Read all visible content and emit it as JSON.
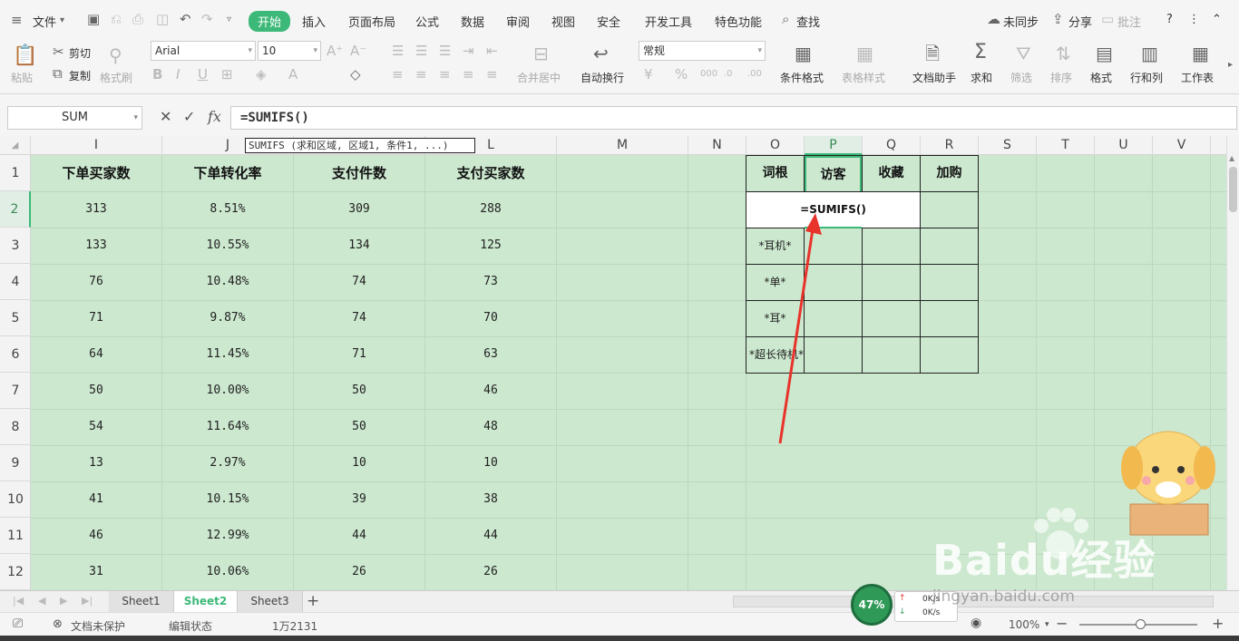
{
  "menu": {
    "file": "文件",
    "items": [
      "开始",
      "插入",
      "页面布局",
      "公式",
      "数据",
      "审阅",
      "视图",
      "安全",
      "开发工具",
      "特色功能"
    ],
    "search": "查找",
    "sync": "未同步",
    "share": "分享",
    "comment": "批注"
  },
  "ribbon": {
    "paste": "粘贴",
    "cut": "剪切",
    "copy": "复制",
    "format_painter": "格式刷",
    "font": "Arial",
    "size": "10",
    "merge": "合并居中",
    "wrap": "自动换行",
    "number_format": "常规",
    "cond_format": "条件格式",
    "table_style": "表格样式",
    "doc_helper": "文档助手",
    "sum": "求和",
    "filter": "筛选",
    "sort": "排序",
    "format": "格式",
    "rowcol": "行和列",
    "sheet": "工作表"
  },
  "formula_bar": {
    "name_box": "SUM",
    "fx": "fx",
    "formula": "=SUMIFS()"
  },
  "tooltip": "SUMIFS (求和区域, 区域1, 条件1, ...)",
  "columns": [
    "I",
    "J",
    "K",
    "L",
    "M",
    "N",
    "O",
    "P",
    "Q",
    "R",
    "S",
    "T",
    "U",
    "V"
  ],
  "rows": [
    "1",
    "2",
    "3",
    "4",
    "5",
    "6",
    "7",
    "8",
    "9",
    "10",
    "11",
    "12"
  ],
  "data_headers": [
    "下单买家数",
    "下单转化率",
    "支付件数",
    "支付买家数"
  ],
  "data_rows": [
    [
      "313",
      "8.51%",
      "309",
      "288"
    ],
    [
      "133",
      "10.55%",
      "134",
      "125"
    ],
    [
      "76",
      "10.48%",
      "74",
      "73"
    ],
    [
      "71",
      "9.87%",
      "74",
      "70"
    ],
    [
      "64",
      "11.45%",
      "71",
      "63"
    ],
    [
      "50",
      "10.00%",
      "50",
      "46"
    ],
    [
      "54",
      "11.64%",
      "50",
      "48"
    ],
    [
      "13",
      "2.97%",
      "10",
      "10"
    ],
    [
      "41",
      "10.15%",
      "39",
      "38"
    ],
    [
      "46",
      "12.99%",
      "44",
      "44"
    ],
    [
      "31",
      "10.06%",
      "26",
      "26"
    ]
  ],
  "side_table": {
    "headers": [
      "词根",
      "访客",
      "收藏",
      "加购"
    ],
    "editing": "=SUMIFS()",
    "roots": [
      "*耳机*",
      "*单*",
      "*耳*",
      "*超长待机*"
    ]
  },
  "sheets": [
    "Sheet1",
    "Sheet2",
    "Sheet3"
  ],
  "status": {
    "protect": "文档未保护",
    "mode": "编辑状态",
    "count": "1万2131",
    "zoom": "100%"
  },
  "network": {
    "percent": "47%",
    "up": "0K/s",
    "down": "0K/s"
  },
  "watermark": {
    "brand": "Baidu经验",
    "url": "jingyan.baidu.com"
  },
  "colors": {
    "accent": "#3cb878",
    "cell_bg": "#cce8cf",
    "arrow": "#e8332b"
  }
}
